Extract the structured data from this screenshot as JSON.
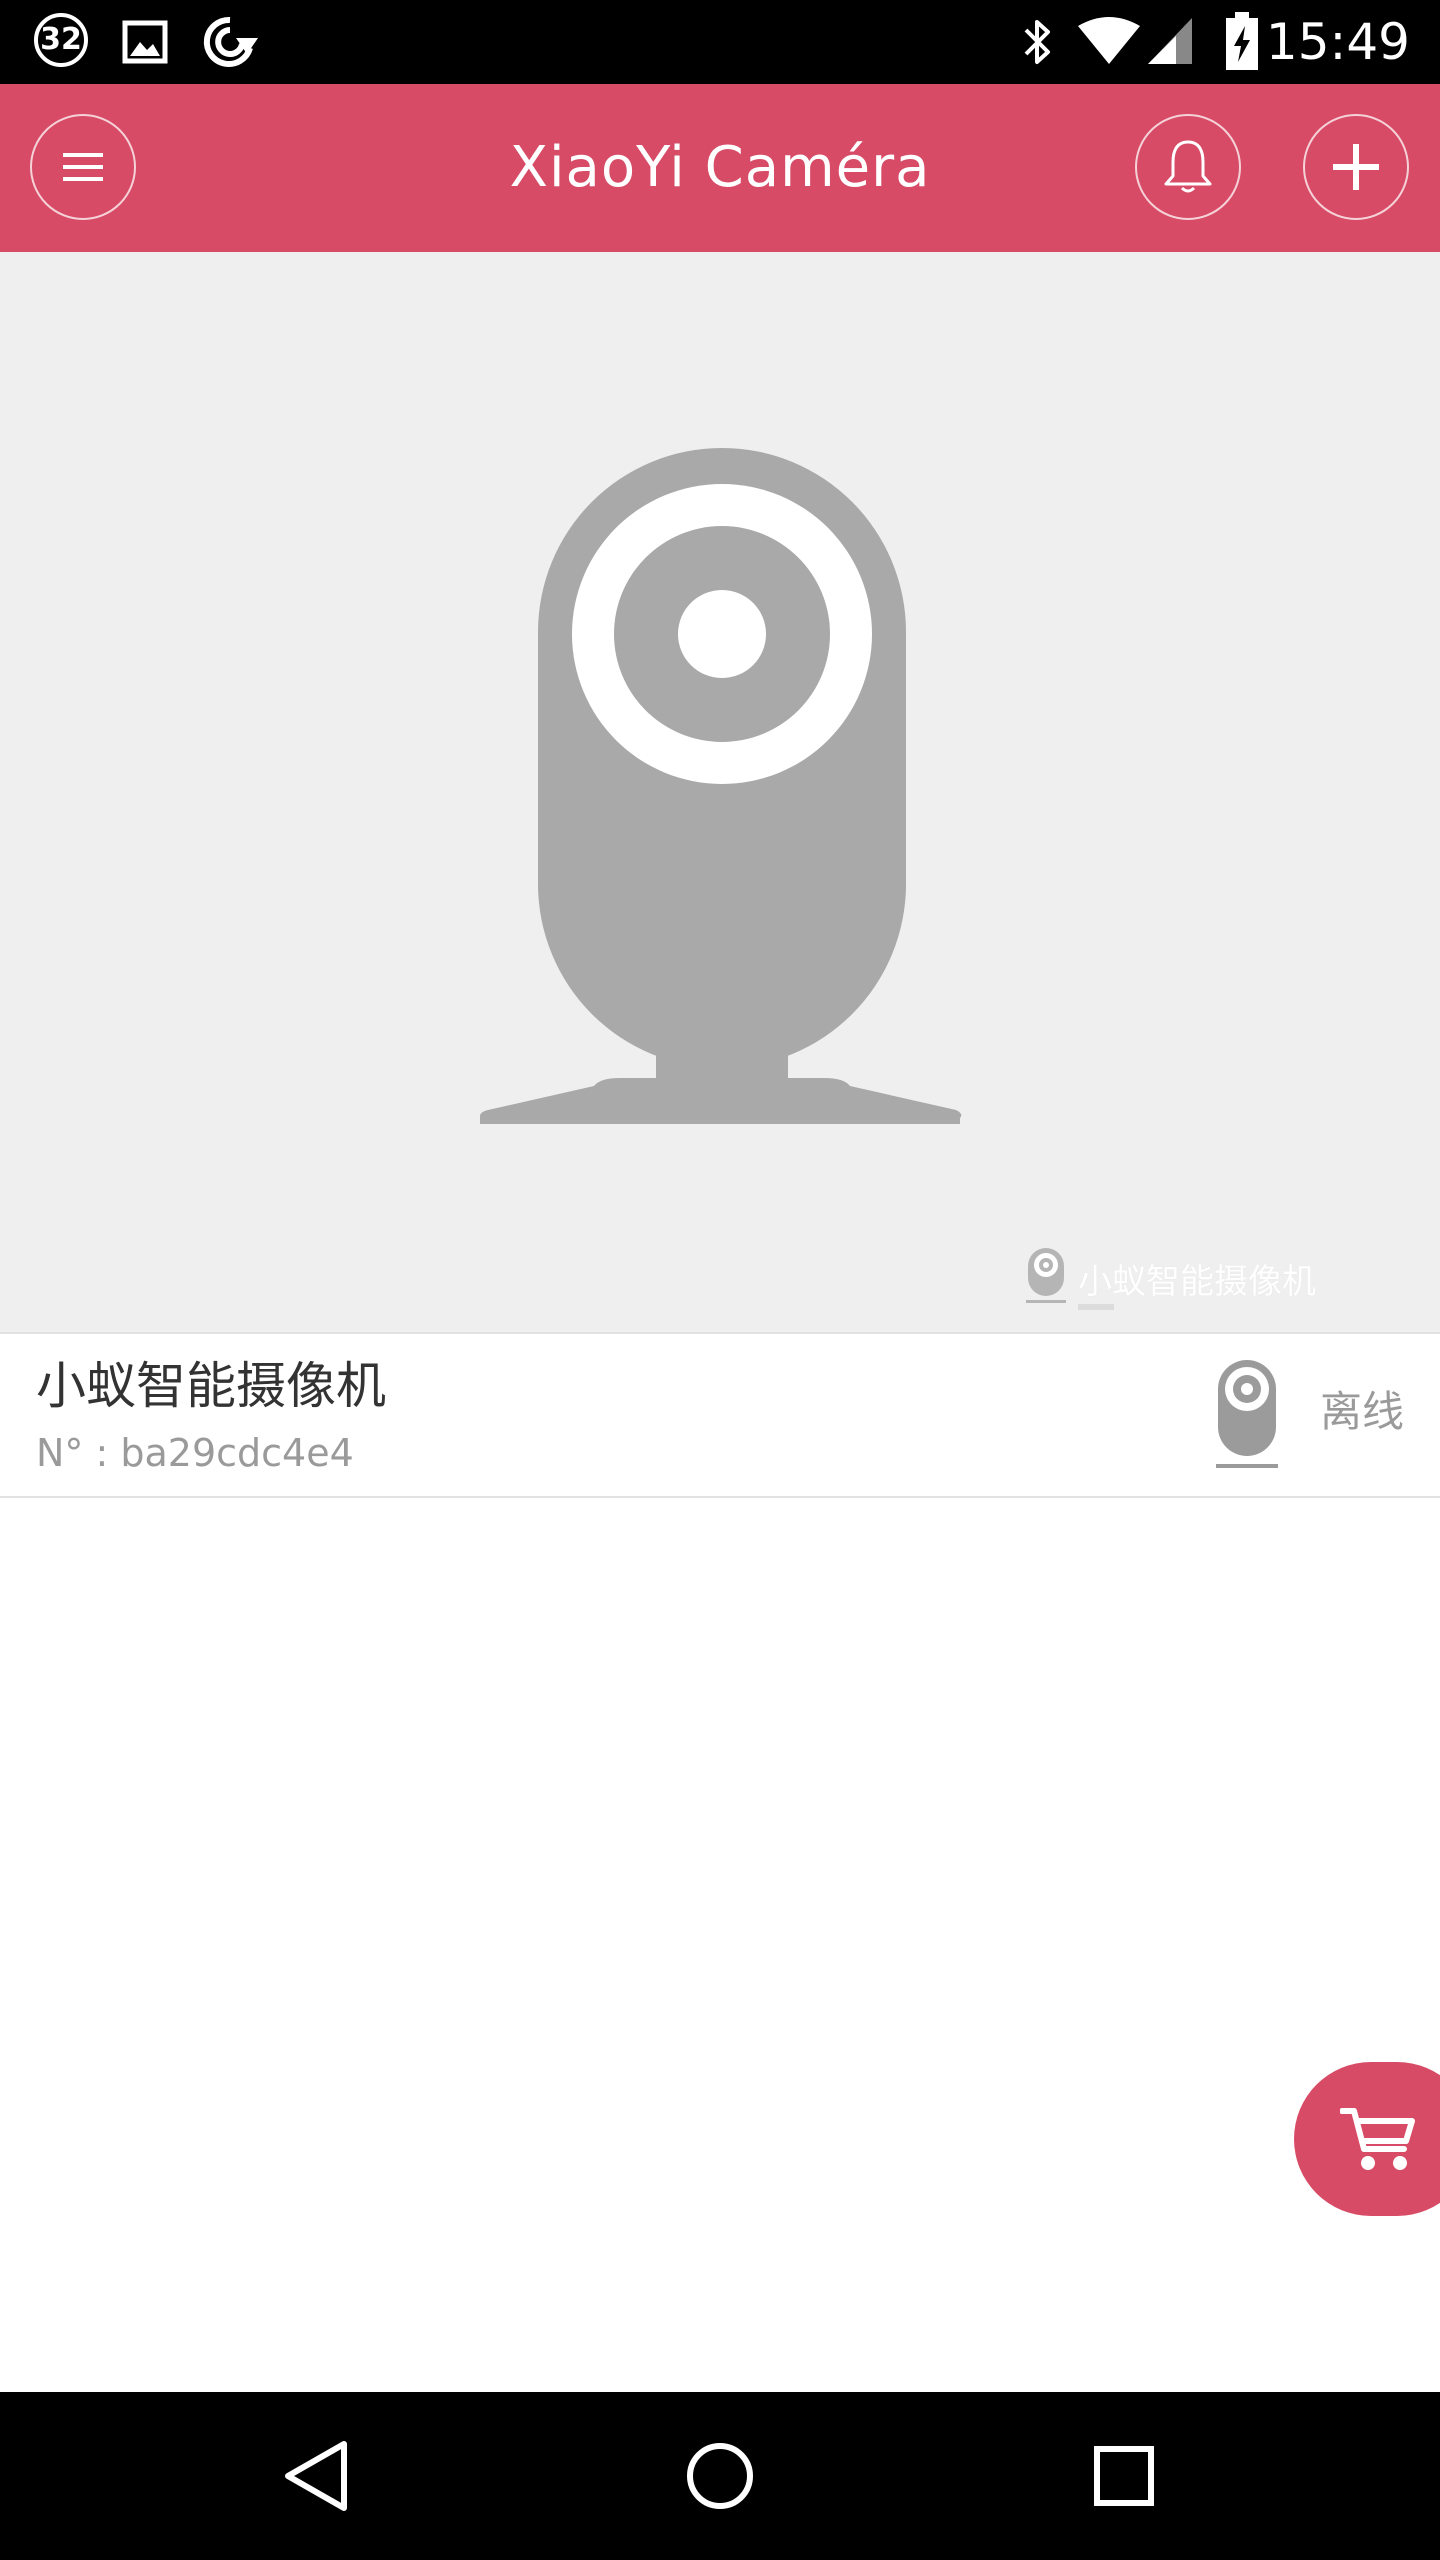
{
  "status_bar": {
    "notification_count": "32",
    "time": "15:49",
    "icons": [
      "notification-count-icon",
      "image-icon",
      "sync-icon",
      "bluetooth-icon",
      "wifi-icon",
      "signal-icon",
      "battery-charging-icon"
    ]
  },
  "app_bar": {
    "title": "XiaoYi Caméra",
    "background_color": "#d84b66",
    "menu_icon": "menu-icon",
    "bell_icon": "bell-icon",
    "add_icon": "plus-icon"
  },
  "preview": {
    "caption": "小蚁智能摄像机",
    "background_color": "#efefef",
    "illustration_icon": "camera-illustration-icon"
  },
  "device": {
    "name": "小蚁智能摄像机",
    "serial": "N° : ba29cdc4e4",
    "status": "离线",
    "thumbnail_icon": "camera-thumbnail-icon"
  },
  "cart": {
    "icon": "cart-icon",
    "color": "#d84b66"
  },
  "nav_bar": {
    "back_icon": "back-icon",
    "home_icon": "home-icon",
    "recents_icon": "recents-icon"
  }
}
